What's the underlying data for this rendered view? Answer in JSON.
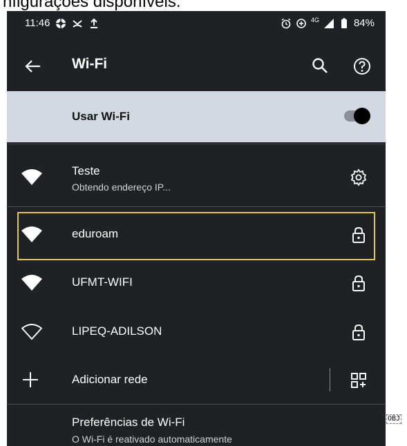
{
  "caption": "nfigurações disponíveis.",
  "status_bar": {
    "time": "11:46",
    "network": "4G",
    "battery": "84%"
  },
  "app_bar": {
    "title": "Wi-Fi"
  },
  "master_toggle": {
    "label": "Usar Wi-Fi",
    "enabled": true
  },
  "networks": [
    {
      "name": "Teste",
      "status": "Obtendo endereço IP...",
      "signal": "full",
      "right_icon": "gear-icon"
    },
    {
      "name": "eduroam",
      "status": "",
      "signal": "full",
      "right_icon": "lock-icon",
      "highlighted": true
    },
    {
      "name": "UFMT-WIFI",
      "status": "",
      "signal": "full",
      "right_icon": "lock-icon"
    },
    {
      "name": "LIPEQ-ADILSON",
      "status": "",
      "signal": "outline",
      "right_icon": "lock-icon"
    }
  ],
  "add_network": {
    "label": "Adicionar rede"
  },
  "preferences": {
    "title": "Preferências de Wi-Fi",
    "subtitle": "O Wi-Fi é reativado automaticamente"
  },
  "corner_tag": "OBJ",
  "colors": {
    "background": "#202124",
    "toggle_row": "#d3d9e3",
    "highlight": "#e2c74a"
  }
}
